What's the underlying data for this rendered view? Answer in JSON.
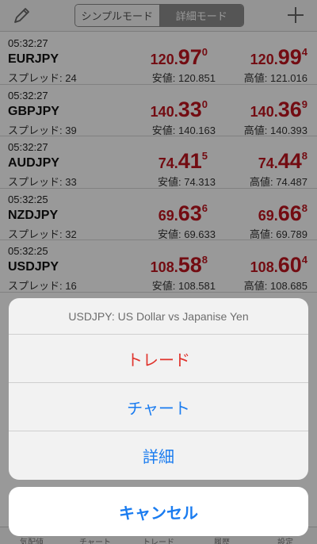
{
  "header": {
    "edit_icon": "pencil-icon",
    "add_icon": "plus-icon",
    "segments": [
      "シンプルモード",
      "詳細モード"
    ],
    "selected_segment": "詳細モード"
  },
  "quotes": [
    {
      "time": "05:32:27",
      "symbol": "EURJPY",
      "spread": "スプレッド: 24",
      "bid": {
        "prefix": "120.",
        "big": "97",
        "sup": "0"
      },
      "ask": {
        "prefix": "120.",
        "big": "99",
        "sup": "4"
      },
      "low": "安値: 120.851",
      "high": "高値: 121.016"
    },
    {
      "time": "05:32:27",
      "symbol": "GBPJPY",
      "spread": "スプレッド: 39",
      "bid": {
        "prefix": "140.",
        "big": "33",
        "sup": "0"
      },
      "ask": {
        "prefix": "140.",
        "big": "36",
        "sup": "9"
      },
      "low": "安値: 140.163",
      "high": "高値: 140.393"
    },
    {
      "time": "05:32:27",
      "symbol": "AUDJPY",
      "spread": "スプレッド: 33",
      "bid": {
        "prefix": "74.",
        "big": "41",
        "sup": "5"
      },
      "ask": {
        "prefix": "74.",
        "big": "44",
        "sup": "8"
      },
      "low": "安値: 74.313",
      "high": "高値: 74.487"
    },
    {
      "time": "05:32:25",
      "symbol": "NZDJPY",
      "spread": "スプレッド: 32",
      "bid": {
        "prefix": "69.",
        "big": "63",
        "sup": "6"
      },
      "ask": {
        "prefix": "69.",
        "big": "66",
        "sup": "8"
      },
      "low": "安値: 69.633",
      "high": "高値: 69.789"
    },
    {
      "time": "05:32:25",
      "symbol": "USDJPY",
      "spread": "スプレッド: 16",
      "bid": {
        "prefix": "108.",
        "big": "58",
        "sup": "8"
      },
      "ask": {
        "prefix": "108.",
        "big": "60",
        "sup": "4"
      },
      "low": "安値: 108.581",
      "high": "高値: 108.685"
    }
  ],
  "action_sheet": {
    "title": "USDJPY: US Dollar vs Japanise Yen",
    "trade": "トレード",
    "chart": "チャート",
    "detail": "詳細",
    "cancel": "キャンセル"
  },
  "tabbar": [
    "気配値",
    "チャート",
    "トレード",
    "履歴",
    "設定"
  ],
  "colors": {
    "price": "#c0151e",
    "destructive": "#e0332c",
    "action": "#1a7cf0"
  }
}
